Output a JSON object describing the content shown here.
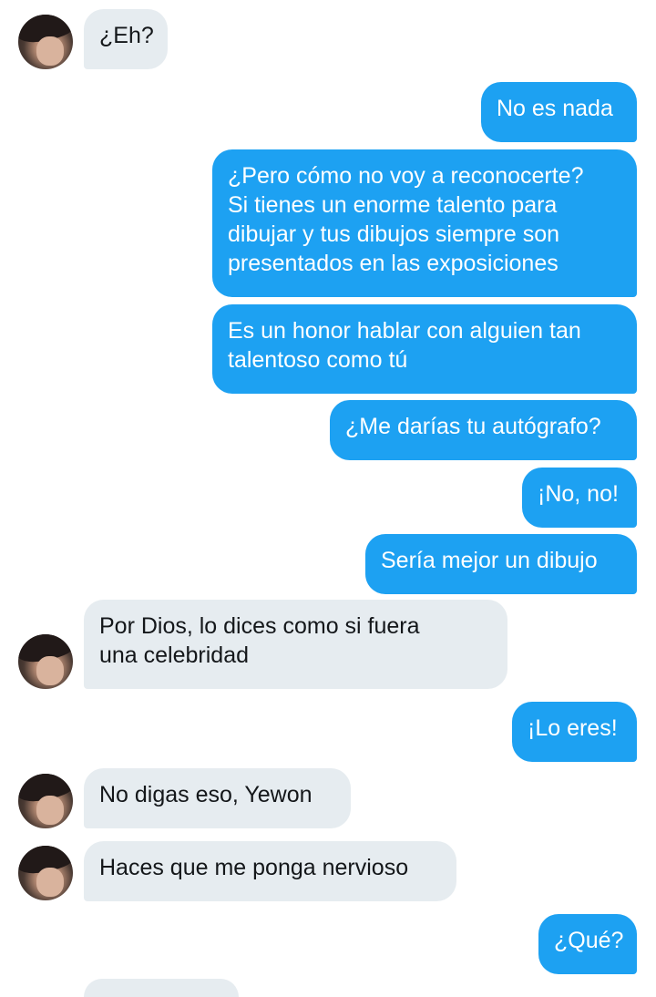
{
  "conversation": {
    "messages": [
      {
        "id": "m1",
        "sender": "other",
        "text": "¿Eh?"
      },
      {
        "id": "m2",
        "sender": "me",
        "text": "No es nada"
      },
      {
        "id": "m3",
        "sender": "me",
        "text": "¿Pero cómo no voy a reconocerte?\nSi tienes un enorme talento para\ndibujar y tus dibujos siempre son\npresentados en las exposiciones"
      },
      {
        "id": "m4",
        "sender": "me",
        "text": "Es un honor hablar con alguien tan\ntalentoso como tú"
      },
      {
        "id": "m5",
        "sender": "me",
        "text": "¿Me darías tu autógrafo?"
      },
      {
        "id": "m6",
        "sender": "me",
        "text": "¡No, no!"
      },
      {
        "id": "m7",
        "sender": "me",
        "text": "Sería mejor un dibujo"
      },
      {
        "id": "m8",
        "sender": "other",
        "text": "Por Dios, lo dices como si fuera\nuna celebridad"
      },
      {
        "id": "m9",
        "sender": "me",
        "text": "¡Lo eres!"
      },
      {
        "id": "m10",
        "sender": "other",
        "text": "No digas eso, Yewon"
      },
      {
        "id": "m11",
        "sender": "other",
        "text": "Haces que me ponga nervioso"
      },
      {
        "id": "m12",
        "sender": "me",
        "text": "¿Qué?"
      }
    ]
  },
  "colors": {
    "sent_bubble": "#1da1f2",
    "received_bubble": "#e6ecf0",
    "sent_text": "#ffffff",
    "received_text": "#14171a"
  }
}
